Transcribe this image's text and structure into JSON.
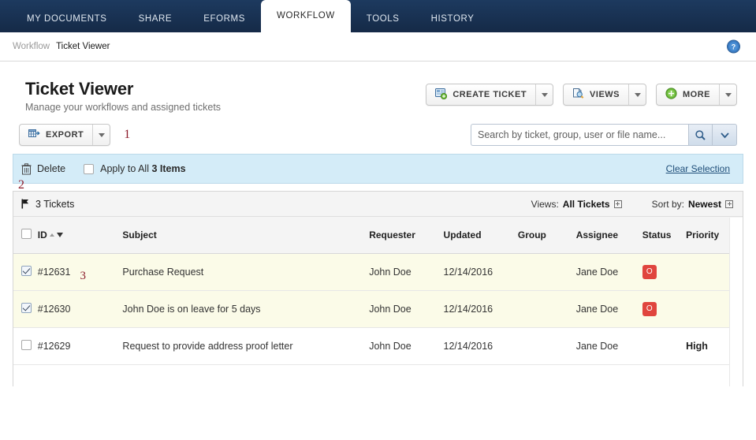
{
  "nav": {
    "tabs": [
      {
        "label": "MY DOCUMENTS",
        "active": false
      },
      {
        "label": "SHARE",
        "active": false
      },
      {
        "label": "EFORMS",
        "active": false
      },
      {
        "label": "WORKFLOW",
        "active": true
      },
      {
        "label": "TOOLS",
        "active": false
      },
      {
        "label": "HISTORY",
        "active": false
      }
    ]
  },
  "breadcrumb": {
    "parent": "Workflow",
    "current": "Ticket Viewer",
    "help_icon": "help-circle-icon"
  },
  "page": {
    "title": "Ticket Viewer",
    "subtitle": "Manage your workflows and assigned tickets"
  },
  "head_actions": [
    {
      "label": "CREATE TICKET",
      "icon": "create-ticket-icon"
    },
    {
      "label": "VIEWS",
      "icon": "views-page-search-icon"
    },
    {
      "label": "MORE",
      "icon": "plus-circle-green-icon"
    }
  ],
  "toolbar": {
    "export_label": "EXPORT",
    "export_icon": "export-table-icon",
    "annotation_1": "1"
  },
  "search": {
    "value": "",
    "placeholder": "Search by ticket, group, user or file name...",
    "search_icon": "magnifier-icon",
    "caret_icon": "chevron-down-icon"
  },
  "selection_bar": {
    "delete_label": "Delete",
    "delete_icon": "trash-icon",
    "apply_prefix": "Apply to All",
    "apply_count": "3 Items",
    "apply_checked": false,
    "clear_label": "Clear Selection",
    "annotation_2": "2"
  },
  "list_header": {
    "flag_icon": "flag-icon",
    "count_label": "3 Tickets",
    "views_prefix": "Views:",
    "views_value": "All Tickets",
    "sort_prefix": "Sort by:",
    "sort_value": "Newest",
    "expand_icon": "expand-box-icon"
  },
  "table": {
    "columns": [
      "ID",
      "Subject",
      "Requester",
      "Updated",
      "Group",
      "Assignee",
      "Status",
      "Priority"
    ],
    "sort_column": "ID",
    "rows": [
      {
        "checked": true,
        "id": "#12631",
        "annotation": "3",
        "subject": "Purchase Request",
        "requester": "John Doe",
        "updated": "12/14/2016",
        "group": "",
        "assignee": "Jane Doe",
        "status": "O",
        "status_type": "badge",
        "priority": "",
        "selected": true
      },
      {
        "checked": true,
        "id": "#12630",
        "annotation": "",
        "subject": "John Doe is on leave for 5 days",
        "requester": "John Doe",
        "updated": "12/14/2016",
        "group": "",
        "assignee": "Jane Doe",
        "status": "O",
        "status_type": "badge",
        "priority": "",
        "selected": true
      },
      {
        "checked": false,
        "id": "#12629",
        "annotation": "",
        "subject": "Request to provide address proof letter",
        "requester": "John Doe",
        "updated": "12/14/2016",
        "group": "",
        "assignee": "Jane Doe",
        "status": "",
        "status_type": "none",
        "priority": "High",
        "selected": false
      }
    ]
  },
  "colors": {
    "nav_bg": "#1b3456",
    "selection_bar_bg": "#d4ecf8",
    "row_selected_bg": "#fbfbe8",
    "status_badge": "#e0453e",
    "annotation": "#8c1c2b",
    "link": "#1f4e79"
  }
}
